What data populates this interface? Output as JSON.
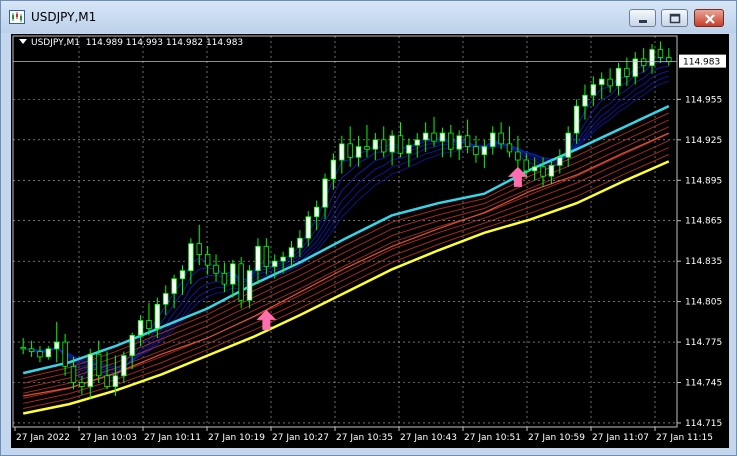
{
  "window": {
    "title": "USDJPY,M1"
  },
  "chart_header": {
    "symbol_tf": "USDJPY,M1",
    "ohlc": "114.989 114.993 114.982 114.983"
  },
  "current_price": "114.983",
  "colors": {
    "background": "#000000",
    "grid": "#ffffff",
    "bull": "#ffffff",
    "bear": "#000000",
    "wick": "#00ff00",
    "upper_bands": "#1020d0",
    "middle_line": "#36d6e8",
    "lower_bands": "#c0301c",
    "bottom_line": "#ffff30",
    "arrow": "#ff6fb0"
  },
  "chart_data": {
    "type": "candlestick",
    "ylim": [
      114.712,
      115.002
    ],
    "y_ticks": [
      "114.955",
      "114.925",
      "114.895",
      "114.865",
      "114.835",
      "114.805",
      "114.775",
      "114.745",
      "114.715"
    ],
    "x_ticks": [
      "27 Jan 2022",
      "27 Jan 10:03",
      "27 Jan 10:11",
      "27 Jan 10:19",
      "27 Jan 10:27",
      "27 Jan 10:35",
      "27 Jan 10:43",
      "27 Jan 10:51",
      "27 Jan 10:59",
      "27 Jan 11:07",
      "27 Jan 11:15"
    ],
    "candles": [
      [
        114.771,
        114.778,
        114.766,
        114.77
      ],
      [
        114.77,
        114.776,
        114.764,
        114.768
      ],
      [
        114.768,
        114.772,
        114.76,
        114.764
      ],
      [
        114.764,
        114.772,
        114.762,
        114.77
      ],
      [
        114.77,
        114.79,
        114.76,
        114.775
      ],
      [
        114.775,
        114.781,
        114.75,
        114.757
      ],
      [
        114.757,
        114.764,
        114.74,
        114.745
      ],
      [
        114.745,
        114.75,
        114.736,
        114.742
      ],
      [
        114.742,
        114.77,
        114.733,
        114.766
      ],
      [
        114.766,
        114.776,
        114.745,
        114.75
      ],
      [
        114.75,
        114.768,
        114.74,
        114.742
      ],
      [
        114.742,
        114.765,
        114.735,
        114.75
      ],
      [
        114.75,
        114.768,
        114.745,
        114.765
      ],
      [
        114.765,
        114.782,
        114.755,
        114.78
      ],
      [
        114.78,
        114.795,
        114.772,
        114.791
      ],
      [
        114.791,
        114.804,
        114.78,
        114.785
      ],
      [
        114.785,
        114.808,
        114.778,
        114.803
      ],
      [
        114.803,
        114.817,
        114.795,
        114.811
      ],
      [
        114.811,
        114.825,
        114.8,
        114.822
      ],
      [
        114.822,
        114.832,
        114.81,
        114.828
      ],
      [
        114.828,
        114.852,
        114.818,
        114.848
      ],
      [
        114.848,
        114.862,
        114.832,
        114.84
      ],
      [
        114.84,
        114.846,
        114.825,
        114.832
      ],
      [
        114.832,
        114.84,
        114.82,
        114.826
      ],
      [
        114.826,
        114.834,
        114.812,
        114.818
      ],
      [
        114.818,
        114.836,
        114.808,
        114.833
      ],
      [
        114.833,
        114.838,
        114.8,
        114.806
      ],
      [
        114.806,
        114.832,
        114.8,
        114.828
      ],
      [
        114.828,
        114.852,
        114.818,
        114.846
      ],
      [
        114.846,
        114.852,
        114.825,
        114.831
      ],
      [
        114.831,
        114.84,
        114.822,
        114.835
      ],
      [
        114.835,
        114.842,
        114.826,
        114.838
      ],
      [
        114.838,
        114.85,
        114.83,
        114.845
      ],
      [
        114.845,
        114.858,
        114.838,
        114.852
      ],
      [
        114.852,
        114.872,
        114.846,
        114.868
      ],
      [
        114.868,
        114.88,
        114.858,
        114.875
      ],
      [
        114.875,
        114.9,
        114.866,
        114.896
      ],
      [
        114.896,
        114.915,
        114.888,
        114.91
      ],
      [
        114.91,
        114.928,
        114.9,
        114.922
      ],
      [
        114.922,
        114.935,
        114.905,
        114.912
      ],
      [
        114.912,
        114.928,
        114.905,
        114.92
      ],
      [
        114.92,
        114.936,
        114.912,
        114.918
      ],
      [
        114.918,
        114.93,
        114.91,
        114.925
      ],
      [
        114.925,
        114.935,
        114.912,
        114.916
      ],
      [
        114.916,
        114.932,
        114.906,
        114.928
      ],
      [
        114.928,
        114.938,
        114.912,
        114.915
      ],
      [
        114.915,
        114.926,
        114.905,
        114.921
      ],
      [
        114.921,
        114.93,
        114.912,
        114.925
      ],
      [
        114.925,
        114.938,
        114.916,
        114.93
      ],
      [
        114.93,
        114.942,
        114.92,
        114.924
      ],
      [
        114.924,
        114.934,
        114.912,
        114.93
      ],
      [
        114.93,
        114.936,
        114.912,
        114.918
      ],
      [
        114.918,
        114.932,
        114.91,
        114.928
      ],
      [
        114.928,
        114.94,
        114.915,
        114.92
      ],
      [
        114.92,
        114.928,
        114.908,
        114.914
      ],
      [
        114.914,
        114.925,
        114.904,
        114.92
      ],
      [
        114.92,
        114.935,
        114.914,
        114.93
      ],
      [
        114.93,
        114.938,
        114.918,
        114.922
      ],
      [
        114.922,
        114.935,
        114.912,
        114.916
      ],
      [
        114.916,
        114.928,
        114.904,
        114.91
      ],
      [
        114.91,
        114.915,
        114.896,
        114.902
      ],
      [
        114.902,
        114.912,
        114.895,
        114.905
      ],
      [
        114.905,
        114.912,
        114.89,
        114.898
      ],
      [
        114.898,
        114.91,
        114.892,
        114.906
      ],
      [
        114.906,
        114.918,
        114.9,
        114.912
      ],
      [
        114.912,
        114.935,
        114.905,
        114.93
      ],
      [
        114.93,
        114.955,
        114.922,
        114.95
      ],
      [
        114.95,
        114.966,
        114.94,
        114.958
      ],
      [
        114.958,
        114.972,
        114.95,
        114.966
      ],
      [
        114.966,
        114.975,
        114.955,
        114.97
      ],
      [
        114.97,
        114.978,
        114.96,
        114.965
      ],
      [
        114.965,
        114.982,
        114.958,
        114.978
      ],
      [
        114.978,
        114.986,
        114.965,
        114.972
      ],
      [
        114.972,
        114.99,
        114.966,
        114.985
      ],
      [
        114.985,
        114.993,
        114.975,
        114.98
      ],
      [
        114.98,
        114.996,
        114.974,
        114.992
      ],
      [
        114.992,
        114.998,
        114.982,
        114.986
      ],
      [
        114.986,
        114.993,
        114.98,
        114.983
      ]
    ],
    "series": [
      {
        "values": [
          114.752,
          114.76,
          114.772,
          114.786,
          114.8,
          114.818,
          114.834,
          114.852,
          114.869,
          114.878,
          114.885,
          114.903,
          114.918,
          114.934,
          114.95
        ]
      },
      {
        "values": [
          114.735,
          114.741,
          114.752,
          114.766,
          114.778,
          114.794,
          114.812,
          114.83,
          114.846,
          114.859,
          114.871,
          114.887,
          114.899,
          114.915,
          114.93
        ]
      },
      {
        "values": [
          114.722,
          114.729,
          114.739,
          114.751,
          114.765,
          114.779,
          114.795,
          114.812,
          114.829,
          114.843,
          114.856,
          114.866,
          114.878,
          114.894,
          114.909
        ]
      }
    ],
    "arrows": [
      {
        "x_index": 29,
        "price": 114.79
      },
      {
        "x_index": 59,
        "price": 114.896
      }
    ]
  }
}
